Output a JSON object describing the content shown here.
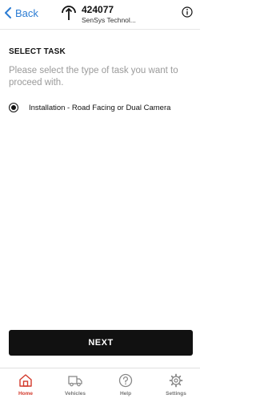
{
  "header": {
    "back_label": "Back",
    "unit_id": "424077",
    "unit_subtitle": "SenSys Technol...",
    "accent_color": "#2b7cd3"
  },
  "main": {
    "section_title": "SELECT TASK",
    "instruction": "Please select the type of task you want to proceed with.",
    "options": [
      {
        "label": "Installation - Road Facing or Dual Camera",
        "selected": true
      }
    ],
    "next_label": "NEXT"
  },
  "tabbar": {
    "active_color": "#d33a2c",
    "tabs": [
      {
        "label": "Home",
        "icon": "home-icon",
        "active": true
      },
      {
        "label": "Vehicles",
        "icon": "truck-icon",
        "active": false
      },
      {
        "label": "Help",
        "icon": "help-icon",
        "active": false
      },
      {
        "label": "Settings",
        "icon": "gear-icon",
        "active": false
      }
    ]
  }
}
